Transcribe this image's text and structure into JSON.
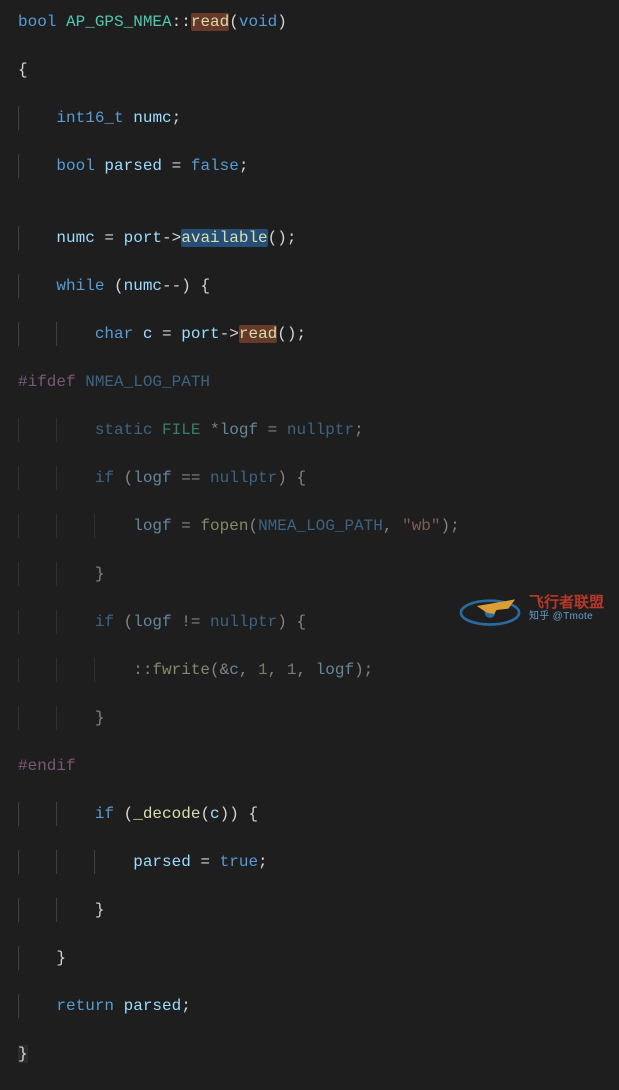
{
  "code": {
    "l1_bool": "bool",
    "l1_cls": "AP_GPS_NMEA",
    "l1_dcolon": "::",
    "l1_fn": "read",
    "l1_args": "(",
    "l1_void": "void",
    "l1_close": ")",
    "l2": "{",
    "l3_type": "int16_t",
    "l3_var": "numc",
    "l3_semi": ";",
    "l4_type": "bool",
    "l4_var": "parsed",
    "l4_eq": " = ",
    "l4_false": "false",
    "l4_semi": ";",
    "l6_var": "numc",
    "l6_eq": " = ",
    "l6_port": "port",
    "l6_arrow": "->",
    "l6_fn": "available",
    "l6_call": "();",
    "l7_while": "while",
    "l7_open": " (",
    "l7_var": "numc",
    "l7_op": "--",
    "l7_close": ") {",
    "l8_type": "char",
    "l8_var": "c",
    "l8_eq": " = ",
    "l8_port": "port",
    "l8_arrow": "->",
    "l8_fn": "read",
    "l8_call": "();",
    "l9_ifdef": "#ifdef",
    "l9_macro": " NMEA_LOG_PATH",
    "l10_static": "static",
    "l10_file": " FILE ",
    "l10_star": "*",
    "l10_var": "logf",
    "l10_eq": " = ",
    "l10_null": "nullptr",
    "l10_semi": ";",
    "l11_if": "if",
    "l11_open": " (",
    "l11_var": "logf",
    "l11_eqeq": " == ",
    "l11_null": "nullptr",
    "l11_close": ") {",
    "l12_var": "logf",
    "l12_eq": " = ",
    "l12_fn": "fopen",
    "l12_open": "(",
    "l12_macro": "NMEA_LOG_PATH",
    "l12_comma": ", ",
    "l12_str": "\"wb\"",
    "l12_close": ");",
    "l13": "}",
    "l14_if": "if",
    "l14_open": " (",
    "l14_var": "logf",
    "l14_ne": " != ",
    "l14_null": "nullptr",
    "l14_close": ") {",
    "l15_dcolon": "::",
    "l15_fn": "fwrite",
    "l15_open": "(&",
    "l15_c": "c",
    "l15_c1": ", ",
    "l15_n1": "1",
    "l15_c2": ", ",
    "l15_n2": "1",
    "l15_c3": ", ",
    "l15_logf": "logf",
    "l15_close": ");",
    "l16": "}",
    "l17": "#endif",
    "l18_if": "if",
    "l18_open": " (",
    "l18_fn": "_decode",
    "l18_p1": "(",
    "l18_var": "c",
    "l18_p2": ")) {",
    "l19_var": "parsed",
    "l19_eq": " = ",
    "l19_true": "true",
    "l19_semi": ";",
    "l20": "}",
    "l21": "}",
    "l22_ret": "return",
    "l22_var": " parsed",
    "l22_semi": ";",
    "l23": "}"
  },
  "watermark": {
    "cn": "飞行者联盟",
    "en": "知乎 @Tmote"
  }
}
